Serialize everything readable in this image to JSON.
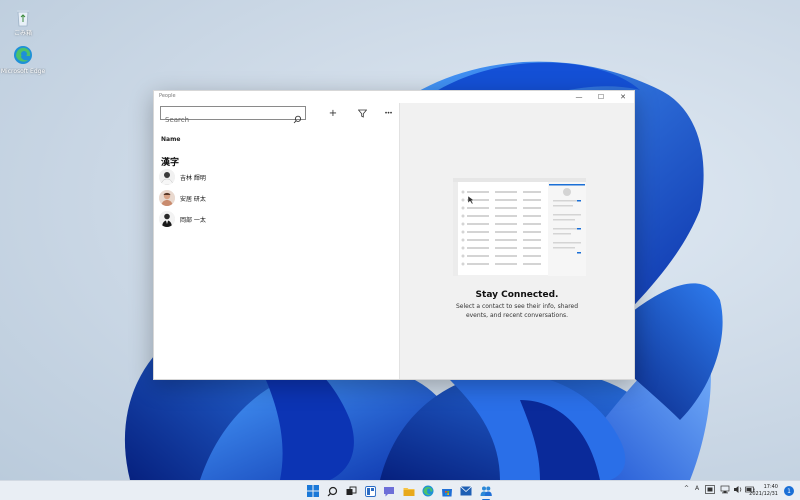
{
  "desktop": {
    "icons": [
      {
        "label": "ごみ箱",
        "icon": "recycle-bin-icon"
      },
      {
        "label": "Microsoft Edge",
        "icon": "edge-icon"
      }
    ]
  },
  "window": {
    "title": "People",
    "controls": {
      "minimize": "—",
      "maximize": "☐",
      "close": "✕"
    }
  },
  "left_pane": {
    "search": {
      "placeholder": "Search",
      "value": ""
    },
    "toolbar": {
      "add": "+",
      "filter": "filter-icon",
      "more": "•••"
    },
    "column_header": "Name",
    "groups": [
      {
        "header": "漢字",
        "contacts": [
          {
            "name": "吉林 輝明",
            "avatar": "avatar-icon"
          },
          {
            "name": "安居 研太",
            "avatar": "avatar-icon"
          },
          {
            "name": "岡部 一太",
            "avatar": "avatar-icon"
          }
        ]
      }
    ]
  },
  "right_pane": {
    "title": "Stay Connected.",
    "description": "Select a contact to see their info, shared events, and recent conversations."
  },
  "taskbar": {
    "apps": [
      "start-icon",
      "search-icon",
      "task-view-icon",
      "widgets-icon",
      "chat-icon",
      "file-explorer-icon",
      "edge-icon",
      "store-icon",
      "mail-icon",
      "people-icon"
    ],
    "tray": {
      "chevron": "^",
      "language": "A"
    },
    "clock": {
      "time": "17:40",
      "date": "2021/12/31"
    },
    "notifications": "1"
  },
  "colors": {
    "accent": "#1a6fd6",
    "bloom_dark": "#0a2fa8",
    "bloom_light": "#3d8cf0",
    "window_right_bg": "#f1f1f1"
  }
}
